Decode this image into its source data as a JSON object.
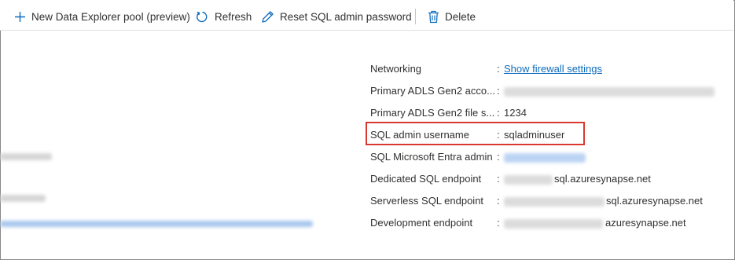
{
  "toolbar": {
    "new_pool_label": "New Data Explorer pool (preview)",
    "refresh_label": "Refresh",
    "reset_password_label": "Reset SQL admin password",
    "delete_label": "Delete",
    "icons": [
      "plus-icon",
      "refresh-icon",
      "pencil-icon",
      "trash-icon"
    ]
  },
  "essentials": {
    "rows": [
      {
        "label": "Networking",
        "value": "Show firewall settings",
        "value_type": "link"
      },
      {
        "label": "Primary ADLS Gen2 acco...",
        "value": "",
        "value_type": "redacted"
      },
      {
        "label": "Primary ADLS Gen2 file s...",
        "value": "1234",
        "value_type": "text"
      },
      {
        "label": "SQL admin username",
        "value": "sqladminuser",
        "value_type": "text",
        "highlighted": true
      },
      {
        "label": "SQL Microsoft Entra admin",
        "value": "",
        "value_type": "redacted-link"
      },
      {
        "label": "Dedicated SQL endpoint",
        "value": "sql.azuresynapse.net",
        "value_type": "partial-redacted"
      },
      {
        "label": "Serverless SQL endpoint",
        "value": "sql.azuresynapse.net",
        "value_type": "partial-redacted"
      },
      {
        "label": "Development endpoint",
        "value": "azuresynapse.net",
        "value_type": "partial-redacted"
      }
    ],
    "separator": ":"
  },
  "colors": {
    "highlight_border": "#d9382d",
    "link": "#0f6cbd",
    "toolbar_icon": "#0f6cbd"
  }
}
